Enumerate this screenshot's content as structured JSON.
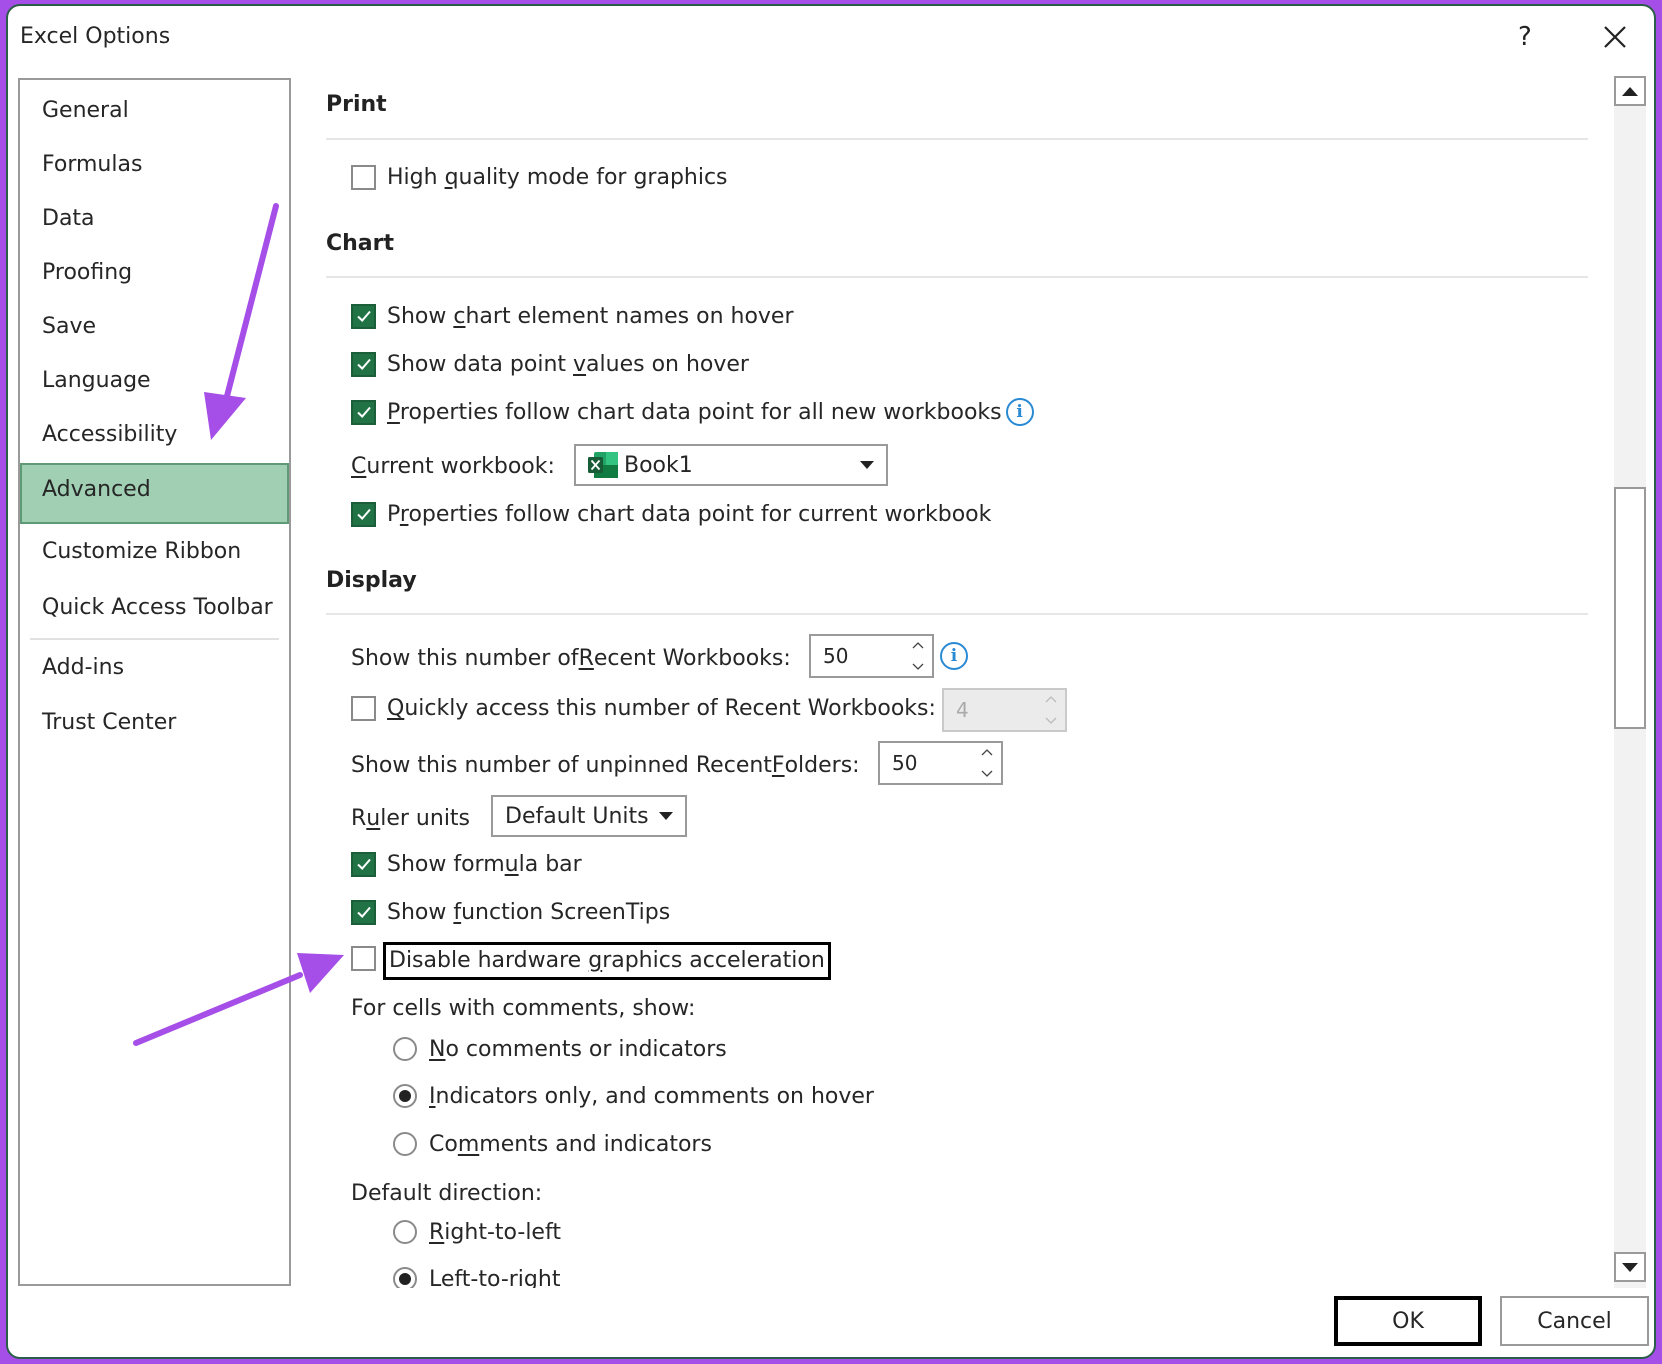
{
  "window": {
    "title": "Excel Options",
    "help_label": "?",
    "close_icon": "close-icon"
  },
  "sidebar": {
    "items": [
      {
        "label": "General"
      },
      {
        "label": "Formulas"
      },
      {
        "label": "Data"
      },
      {
        "label": "Proofing"
      },
      {
        "label": "Save"
      },
      {
        "label": "Language"
      },
      {
        "label": "Accessibility"
      },
      {
        "label": "Advanced",
        "selected": true
      },
      {
        "label": "Customize Ribbon"
      },
      {
        "label": "Quick Access Toolbar"
      },
      {
        "label": "Add-ins"
      },
      {
        "label": "Trust Center"
      }
    ]
  },
  "sections": {
    "print": {
      "heading": "Print",
      "high_quality": {
        "pre": "High ",
        "u": "q",
        "post": "uality mode for graphics",
        "checked": false
      }
    },
    "chart": {
      "heading": "Chart",
      "element_names": {
        "pre": "Show ",
        "u": "c",
        "post": "hart element names on hover",
        "checked": true
      },
      "data_point_values": {
        "pre": "Show data point ",
        "u": "v",
        "post": "alues on hover",
        "checked": true
      },
      "props_all_new": {
        "pre": "",
        "u": "P",
        "post": "roperties follow chart data point for all new workbooks",
        "checked": true
      },
      "current_workbook": {
        "label_u": "C",
        "label_post": "urrent workbook:",
        "value": "Book1",
        "icon": "excel-icon"
      },
      "props_current": {
        "pre": "P",
        "u": "r",
        "post": "operties follow chart data point for current workbook",
        "checked": true
      }
    },
    "display": {
      "heading": "Display",
      "recent_workbooks": {
        "pre": "Show this number of ",
        "u": "R",
        "post": "ecent Workbooks:",
        "value": "50"
      },
      "quick_access": {
        "pre": "",
        "u": "Q",
        "post": "uickly access this number of Recent Workbooks:",
        "checked": false,
        "value": "4",
        "disabled": true
      },
      "recent_folders": {
        "pre": "Show this number of unpinned Recent ",
        "u": "F",
        "post": "olders:",
        "value": "50"
      },
      "ruler_units": {
        "pre": "R",
        "u": "u",
        "post": "ler units",
        "value": "Default Units"
      },
      "formula_bar": {
        "pre": "Show form",
        "u": "u",
        "post": "la bar",
        "checked": true
      },
      "screentips": {
        "pre": "Show ",
        "u": "f",
        "post": "unction ScreenTips",
        "checked": true
      },
      "disable_hw_accel": {
        "pre": "Disable hardware ",
        "u": "g",
        "post": "raphics acceleration",
        "checked": false
      },
      "comments_label": "For cells with comments, show:",
      "comments_options": [
        {
          "pre": "",
          "u": "N",
          "post": "o comments or indicators",
          "selected": false
        },
        {
          "pre": "",
          "u": "I",
          "post": "ndicators only, and comments on hover",
          "selected": true
        },
        {
          "pre": "Co",
          "u": "m",
          "post": "ments and indicators",
          "selected": false
        }
      ],
      "direction_label": "Default direction:",
      "direction_options": [
        {
          "pre": "",
          "u": "R",
          "post": "ight-to-left",
          "selected": false
        },
        {
          "pre": "",
          "u": "L",
          "post": "eft-to-right",
          "selected": true
        }
      ]
    }
  },
  "footer": {
    "ok_label": "OK",
    "cancel_label": "Cancel"
  },
  "colors": {
    "accent_green": "#217346",
    "selected_nav": "#a0cfb3",
    "info_blue": "#2a8ad4",
    "annotation_arrow": "#a64ee8"
  }
}
